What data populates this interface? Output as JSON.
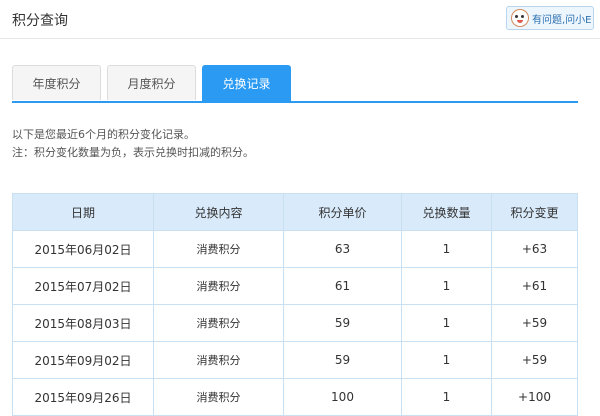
{
  "header": {
    "title": "积分查询",
    "help_label": "有问题,问小E"
  },
  "tabs": [
    {
      "label": "年度积分",
      "active": false
    },
    {
      "label": "月度积分",
      "active": false
    },
    {
      "label": "兑换记录",
      "active": true
    }
  ],
  "notes": {
    "line1": "以下是您最近6个月的积分变化记录。",
    "line2": "注：积分变化数量为负，表示兑换时扣减的积分。"
  },
  "table": {
    "headers": [
      "日期",
      "兑换内容",
      "积分单价",
      "兑换数量",
      "积分变更"
    ],
    "rows": [
      [
        "2015年06月02日",
        "消费积分",
        "63",
        "1",
        "+63"
      ],
      [
        "2015年07月02日",
        "消费积分",
        "61",
        "1",
        "+61"
      ],
      [
        "2015年08月03日",
        "消费积分",
        "59",
        "1",
        "+59"
      ],
      [
        "2015年09月02日",
        "消费积分",
        "59",
        "1",
        "+59"
      ],
      [
        "2015年09月26日",
        "消费积分",
        "100",
        "1",
        "+100"
      ]
    ]
  },
  "colors": {
    "accent": "#2b9af3",
    "table_header_bg": "#d9ebfb"
  }
}
